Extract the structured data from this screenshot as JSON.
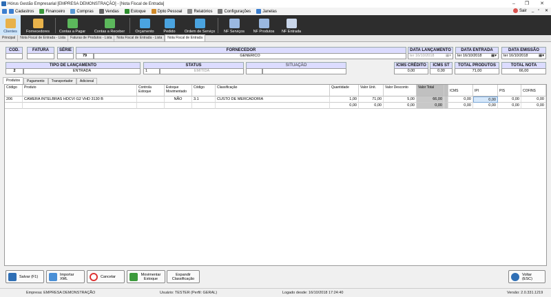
{
  "window": {
    "title": "Hórus Gestão Empresarial [EMPRESA DEMONSTRAÇÃO] - [Nota Fiscal de Entrada]",
    "minimize": "–",
    "maximize": "❐",
    "close": "✕"
  },
  "menu": {
    "items": [
      {
        "label": "Cadastros",
        "color": "#3b7fd0"
      },
      {
        "label": "Financeiro",
        "color": "#3d9a3d"
      },
      {
        "label": "Compras",
        "color": "#5b9bd5"
      },
      {
        "label": "Vendas",
        "color": "#666666"
      },
      {
        "label": "Estoque",
        "color": "#2f8f2f"
      },
      {
        "label": "Dpto Pessoal",
        "color": "#d08a2a"
      },
      {
        "label": "Relatórios",
        "color": "#888888"
      },
      {
        "label": "Configurações",
        "color": "#777777"
      },
      {
        "label": "Janelas",
        "color": "#3b7fd0"
      }
    ],
    "exit": "Sair",
    "mdi_min": "_",
    "mdi_restore": "▫",
    "mdi_close": "✕"
  },
  "toolbar": {
    "buttons": [
      {
        "label": "Clientes",
        "color": "#e8b24a"
      },
      {
        "label": "Fornecedores",
        "color": "#e8b24a"
      },
      {
        "label": "Contas a Pagar",
        "color": "#5cb85c"
      },
      {
        "label": "Contas a Receber",
        "color": "#5cb85c"
      },
      {
        "label": "Orçamento",
        "color": "#4aa3df"
      },
      {
        "label": "Pedido",
        "color": "#4aa3df"
      },
      {
        "label": "Ordem de Serviço",
        "color": "#4aa3df"
      },
      {
        "label": "NF Serviços",
        "color": "#9ab8e0"
      },
      {
        "label": "NF Produtos",
        "color": "#9ab8e0"
      },
      {
        "label": "NF Entrada",
        "color": "#c9d6ea"
      }
    ]
  },
  "doc_tabs": [
    "Principal",
    "Nota Fiscal de Entrada - Lista",
    "Faturas de Produtos - Lista",
    "Nota Fiscal de Entrada - Lista",
    "Nota Fiscal de Entrada"
  ],
  "form": {
    "cod": {
      "label": "COD.",
      "value": ""
    },
    "fatura": {
      "label": "FATURA",
      "value": ""
    },
    "serie": {
      "label": "SÉRIE",
      "value": ""
    },
    "fornecedor": {
      "label": "FORNECEDOR",
      "code": "79",
      "name": "GENERICO"
    },
    "data_lancamento": {
      "label": "DATA LANÇAMENTO",
      "value": "ter 16/10/2018"
    },
    "data_entrada": {
      "label": "DATA ENTRADA",
      "value": "ter 16/10/2018"
    },
    "data_emissao": {
      "label": "DATA EMISSÃO",
      "value": "ter 16/10/2018"
    },
    "tipo_lancamento": {
      "label": "TIPO DE LANÇAMENTO",
      "code": "2",
      "value": "ENTRADA"
    },
    "status": {
      "label": "STATUS",
      "code": "1",
      "value": "EMITIDA"
    },
    "situacao": {
      "label": "SITUAÇÃO",
      "value": ""
    },
    "icms_credito": {
      "label": "ICMS CRÉDITO",
      "value": "0,00"
    },
    "icms_st": {
      "label": "ICMS ST",
      "value": "0,00"
    },
    "total_produtos": {
      "label": "TOTAL PRODUTOS",
      "value": "71,00"
    },
    "total_nota": {
      "label": "TOTAL NOTA",
      "value": "66,00"
    }
  },
  "detail_tabs": [
    "Produtos",
    "Pagamento",
    "Transportador",
    "Adicional"
  ],
  "grid": {
    "headers": {
      "codigo": "Código",
      "produto": "Produto",
      "controla_estoque": "Controla Estoque",
      "estoque_movimentado": "Estoque Movimentado",
      "codigo2": "Código",
      "classificacao": "Classificação",
      "quantidade": "Quantidade",
      "valor_unit": "Valor Unit.",
      "valor_desconto": "Valor Desconto",
      "valor_total": "Valor Total",
      "icms": "ICMS",
      "ipi": "IPI",
      "pis": "PIS",
      "cofins": "COFINS"
    },
    "rows": [
      {
        "codigo": "206",
        "produto": "CAMERA INTELBRAS HDCVI G2 VHD 3130 B",
        "controla_estoque": "",
        "estoque_movimentado": "NÃO",
        "codigo2": "3.1",
        "classificacao": "CUSTO DE MERCADORIA",
        "quantidade": "1,00",
        "valor_unit": "71,00",
        "valor_desconto": "5,00",
        "valor_total": "66,00",
        "icms": "0,00",
        "ipi": "0,00",
        "pis": "0,00",
        "cofins": "0,00"
      }
    ],
    "totals": {
      "quantidade": "0,00",
      "valor_unit": "0,00",
      "valor_desconto": "0,00",
      "valor_total": "0,00",
      "icms": "0,00",
      "ipi": "0,00",
      "pis": "0,00",
      "cofins": "0,00"
    }
  },
  "actions": {
    "salvar": "Salvar (F1)",
    "importar": "Importar XML",
    "cancelar": "Cancelar",
    "movimentar": "Movimentar Estoque",
    "expandir": "Expandir Classificação",
    "voltar": "Voltar (ESC)"
  },
  "status_bar": {
    "empresa": "Empresa: EMPRESA DEMONSTRAÇÃO",
    "usuario": "Usuário: TESTER (Perfil: GERAL)",
    "logado": "Logado desde: 16/10/2018 17:24:40",
    "versao": "Versão: 2.0.331.1219"
  }
}
